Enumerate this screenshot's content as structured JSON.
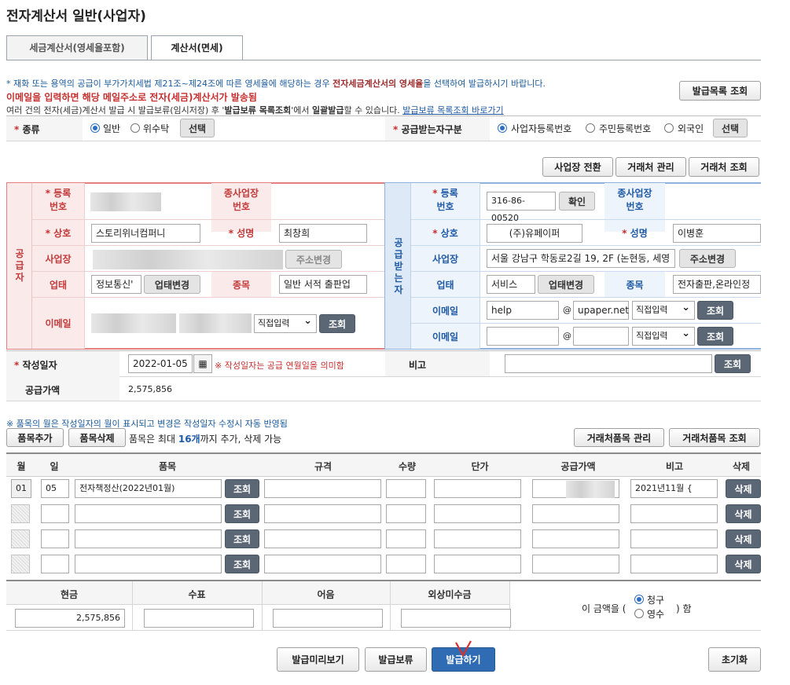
{
  "page": {
    "title": "전자계산서 일반(사업자)"
  },
  "tabs": [
    {
      "label": "세금계산서(영세율포함)",
      "active": false
    },
    {
      "label": "계산서(면세)",
      "active": true
    }
  ],
  "notice": {
    "line1_pre": "* 재화 또는 용역의 공급이 부가가치세법 제21조~제24조에 따른 영세율에 해당하는 경우 ",
    "line1_bold": "전자세금계산서의 영세율",
    "line1_post": "을 선택하여 발급하시기 바랍니다.",
    "line2": "이메일을 입력하면 해당 메일주소로 전자(세금)계산서가 발송됨",
    "line3_pre": "여러 건의 전자(세금)계산서 발급 시 발급보류(임시저장) 후 '",
    "line3_bold1": "발급보류 목록조회",
    "line3_mid": "'에서 ",
    "line3_bold2": "일괄발급",
    "line3_post": "할 수 있습니다. ",
    "line3_link": "발급보류 목록조회 바로가기",
    "issue_list_button": "발급목록 조회"
  },
  "kind_row": {
    "kind_label": "종류",
    "options": [
      "일반",
      "위수탁"
    ],
    "selected": "일반",
    "select_button": "선택",
    "receiver_type_label": "공급받는자구분",
    "receiver_options": [
      "사업자등록번호",
      "주민등록번호",
      "외국인"
    ],
    "receiver_selected": "사업자등록번호",
    "receiver_select_button": "선택"
  },
  "top_buttons": [
    "사업장 전환",
    "거래처 관리",
    "거래처 조회"
  ],
  "supplier": {
    "side_label": "공급자",
    "reg_no_label": "등록\n번호",
    "sub_biz_label": "종사업장\n번호",
    "name_label": "상호",
    "name_value": "스토리위너컴퍼니",
    "ceo_label": "성명",
    "ceo_value": "최창희",
    "address_label": "사업장",
    "address_button": "주소변경",
    "biz_type_label": "업태",
    "biz_type_value": "정보통신'",
    "biz_type_button": "업태변경",
    "item_label": "종목",
    "item_value": "일반 서적 출판업",
    "email_label": "이메일",
    "email_select": "직접입력",
    "email_button": "조회"
  },
  "receiver": {
    "side_label": "공급받는자",
    "reg_no_label": "등록\n번호",
    "reg_no_value": "316-86-00520",
    "reg_no_button": "확인",
    "sub_biz_label": "종사업장\n번호",
    "name_label": "상호",
    "name_value": "(주)유페이퍼",
    "ceo_label": "성명",
    "ceo_value": "이병훈",
    "address_label": "사업장",
    "address_value": "서울 강남구 학동로2길 19, 2F (논현동, 세영",
    "address_button": "주소변경",
    "biz_type_label": "업태",
    "biz_type_value": "서비스",
    "biz_type_button": "업태변경",
    "item_label": "종목",
    "item_value": "전자출판,온라인정",
    "email1_label": "이메일",
    "email1_user": "help",
    "email1_domain": "upaper.net",
    "email1_select": "직접입력",
    "email1_button": "조회",
    "email2_label": "이메일",
    "email2_user": "",
    "email2_domain": "",
    "email2_select": "직접입력",
    "email2_button": "조회",
    "at": "@"
  },
  "date_row": {
    "date_label": "작성일자",
    "date_value": "2022-01-05",
    "date_note": "※ 작성일자는 공급 연월일을 의미함",
    "remark_label": "비고",
    "remark_value": "",
    "remark_button": "조회",
    "supply_label": "공급가액",
    "supply_value": "2,575,856"
  },
  "items": {
    "note": "※ 품목의 월은 작성일자의 월이 표시되고 변경은 작성일자 수정시 자동 반영됨",
    "add_button": "품목추가",
    "delete_button": "품목삭제",
    "limit_pre": "품목은 최대 ",
    "limit_bold": "16개",
    "limit_post": "까지 추가, 삭제 가능",
    "manage_button": "거래처품목 관리",
    "search_button": "거래처품목 조회",
    "headers": [
      "월",
      "일",
      "품목",
      "규격",
      "수량",
      "단가",
      "공급가액",
      "비고",
      "삭제"
    ],
    "rows": [
      {
        "month": "01",
        "day": "05",
        "name": "전자책정산(2022년01월)",
        "spec": "",
        "qty": "",
        "price": "",
        "amount": "",
        "remark": "2021년11월 {",
        "search": "조회",
        "del": "삭제"
      },
      {
        "month": "",
        "day": "",
        "name": "",
        "spec": "",
        "qty": "",
        "price": "",
        "amount": "",
        "remark": "",
        "search": "조회",
        "del": "삭제"
      },
      {
        "month": "",
        "day": "",
        "name": "",
        "spec": "",
        "qty": "",
        "price": "",
        "amount": "",
        "remark": "",
        "search": "조회",
        "del": "삭제"
      },
      {
        "month": "",
        "day": "",
        "name": "",
        "spec": "",
        "qty": "",
        "price": "",
        "amount": "",
        "remark": "",
        "search": "조회",
        "del": "삭제"
      }
    ]
  },
  "payment": {
    "headers": [
      "현금",
      "수표",
      "어음",
      "외상미수금"
    ],
    "values": [
      "2,575,856",
      "",
      "",
      ""
    ],
    "amount_pre": "이 금액을 (",
    "amount_post": ") 함",
    "options": [
      "청구",
      "영수"
    ],
    "selected": "청구"
  },
  "bottom_buttons": {
    "preview": "발급미리보기",
    "hold": "발급보류",
    "issue": "발급하기",
    "reset": "초기화"
  },
  "colors": {
    "supplier_border": "#e37f7f",
    "supplier_label_bg": "#fbeaea",
    "receiver_border": "#8fb2dc",
    "receiver_label_bg": "#dde9f7",
    "accent_red": "#c62f2f",
    "accent_blue": "#1f5aa6"
  }
}
